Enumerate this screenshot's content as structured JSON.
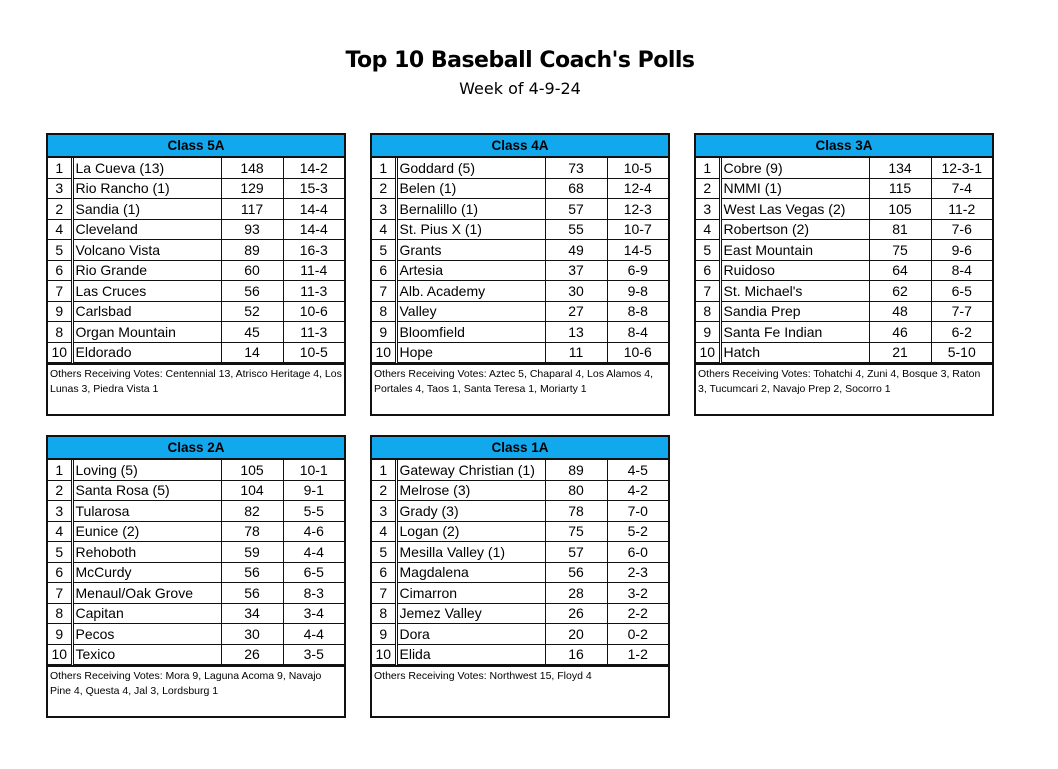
{
  "title": "Top 10 Baseball Coach's Polls",
  "subtitle": "Week of 4-9-24",
  "polls": [
    {
      "class": "Class 5A",
      "rows": [
        [
          "1",
          "La Cueva (13)",
          "148",
          "14-2"
        ],
        [
          "3",
          "Rio Rancho (1)",
          "129",
          "15-3"
        ],
        [
          "2",
          "Sandia (1)",
          "117",
          "14-4"
        ],
        [
          "4",
          "Cleveland",
          "93",
          "14-4"
        ],
        [
          "5",
          "Volcano Vista",
          "89",
          "16-3"
        ],
        [
          "6",
          "Rio Grande",
          "60",
          "11-4"
        ],
        [
          "7",
          "Las Cruces",
          "56",
          "11-3"
        ],
        [
          "9",
          "Carlsbad",
          "52",
          "10-6"
        ],
        [
          "8",
          "Organ Mountain",
          "45",
          "11-3"
        ],
        [
          "10",
          "Eldorado",
          "14",
          "10-5"
        ]
      ],
      "others": "Others Receiving Votes: Centennial 13, Atrisco Heritage 4, Los Lunas 3, Piedra Vista 1"
    },
    {
      "class": "Class 4A",
      "rows": [
        [
          "1",
          "Goddard (5)",
          "73",
          "10-5"
        ],
        [
          "2",
          "Belen (1)",
          "68",
          "12-4"
        ],
        [
          "3",
          "Bernalillo (1)",
          "57",
          "12-3"
        ],
        [
          "4",
          "St. Pius X (1)",
          "55",
          "10-7"
        ],
        [
          "5",
          "Grants",
          "49",
          "14-5"
        ],
        [
          "6",
          "Artesia",
          "37",
          "6-9"
        ],
        [
          "7",
          "Alb. Academy",
          "30",
          "9-8"
        ],
        [
          "8",
          "Valley",
          "27",
          "8-8"
        ],
        [
          "9",
          "Bloomfield",
          "13",
          "8-4"
        ],
        [
          "10",
          "Hope",
          "11",
          "10-6"
        ]
      ],
      "others": "Others Receiving Votes: Aztec 5, Chaparal 4, Los Alamos 4, Portales 4, Taos 1, Santa Teresa 1, Moriarty 1"
    },
    {
      "class": "Class 3A",
      "rows": [
        [
          "1",
          "Cobre (9)",
          "134",
          "12-3-1"
        ],
        [
          "2",
          "NMMI (1)",
          "115",
          "7-4"
        ],
        [
          "3",
          "West Las Vegas (2)",
          "105",
          "11-2"
        ],
        [
          "4",
          "Robertson (2)",
          "81",
          "7-6"
        ],
        [
          "5",
          "East Mountain",
          "75",
          "9-6"
        ],
        [
          "6",
          "Ruidoso",
          "64",
          "8-4"
        ],
        [
          "7",
          "St. Michael's",
          "62",
          "6-5"
        ],
        [
          "8",
          "Sandia Prep",
          "48",
          "7-7"
        ],
        [
          "9",
          "Santa Fe Indian",
          "46",
          "6-2"
        ],
        [
          "10",
          "Hatch",
          "21",
          "5-10"
        ]
      ],
      "others": "Others Receiving Votes: Tohatchi 4, Zuni 4, Bosque 3, Raton 3, Tucumcari 2, Navajo Prep 2, Socorro 1"
    },
    {
      "class": "Class 2A",
      "rows": [
        [
          "1",
          "Loving (5)",
          "105",
          "10-1"
        ],
        [
          "2",
          "Santa Rosa (5)",
          "104",
          "9-1"
        ],
        [
          "3",
          "Tularosa",
          "82",
          "5-5"
        ],
        [
          "4",
          "Eunice (2)",
          "78",
          "4-6"
        ],
        [
          "5",
          "Rehoboth",
          "59",
          "4-4"
        ],
        [
          "6",
          "McCurdy",
          "56",
          "6-5"
        ],
        [
          "7",
          "Menaul/Oak Grove",
          "56",
          "8-3"
        ],
        [
          "8",
          "Capitan",
          "34",
          "3-4"
        ],
        [
          "9",
          "Pecos",
          "30",
          "4-4"
        ],
        [
          "10",
          "Texico",
          "26",
          "3-5"
        ]
      ],
      "others": "Others Receiving Votes: Mora 9, Laguna Acoma 9, Navajo Pine 4, Questa 4, Jal 3, Lordsburg 1"
    },
    {
      "class": "Class 1A",
      "rows": [
        [
          "1",
          "Gateway Christian (1)",
          "89",
          "4-5"
        ],
        [
          "2",
          "Melrose (3)",
          "80",
          "4-2"
        ],
        [
          "3",
          "Grady (3)",
          "78",
          "7-0"
        ],
        [
          "4",
          "Logan (2)",
          "75",
          "5-2"
        ],
        [
          "5",
          "Mesilla Valley (1)",
          "57",
          "6-0"
        ],
        [
          "6",
          "Magdalena",
          "56",
          "2-3"
        ],
        [
          "7",
          "Cimarron",
          "28",
          "3-2"
        ],
        [
          "8",
          "Jemez Valley",
          "26",
          "2-2"
        ],
        [
          "9",
          "Dora",
          "20",
          "0-2"
        ],
        [
          "10",
          "Elida",
          "16",
          "1-2"
        ]
      ],
      "others": "Others Receiving Votes: Northwest 15, Floyd 4"
    }
  ],
  "colors": {
    "header": "#12a8ee"
  }
}
